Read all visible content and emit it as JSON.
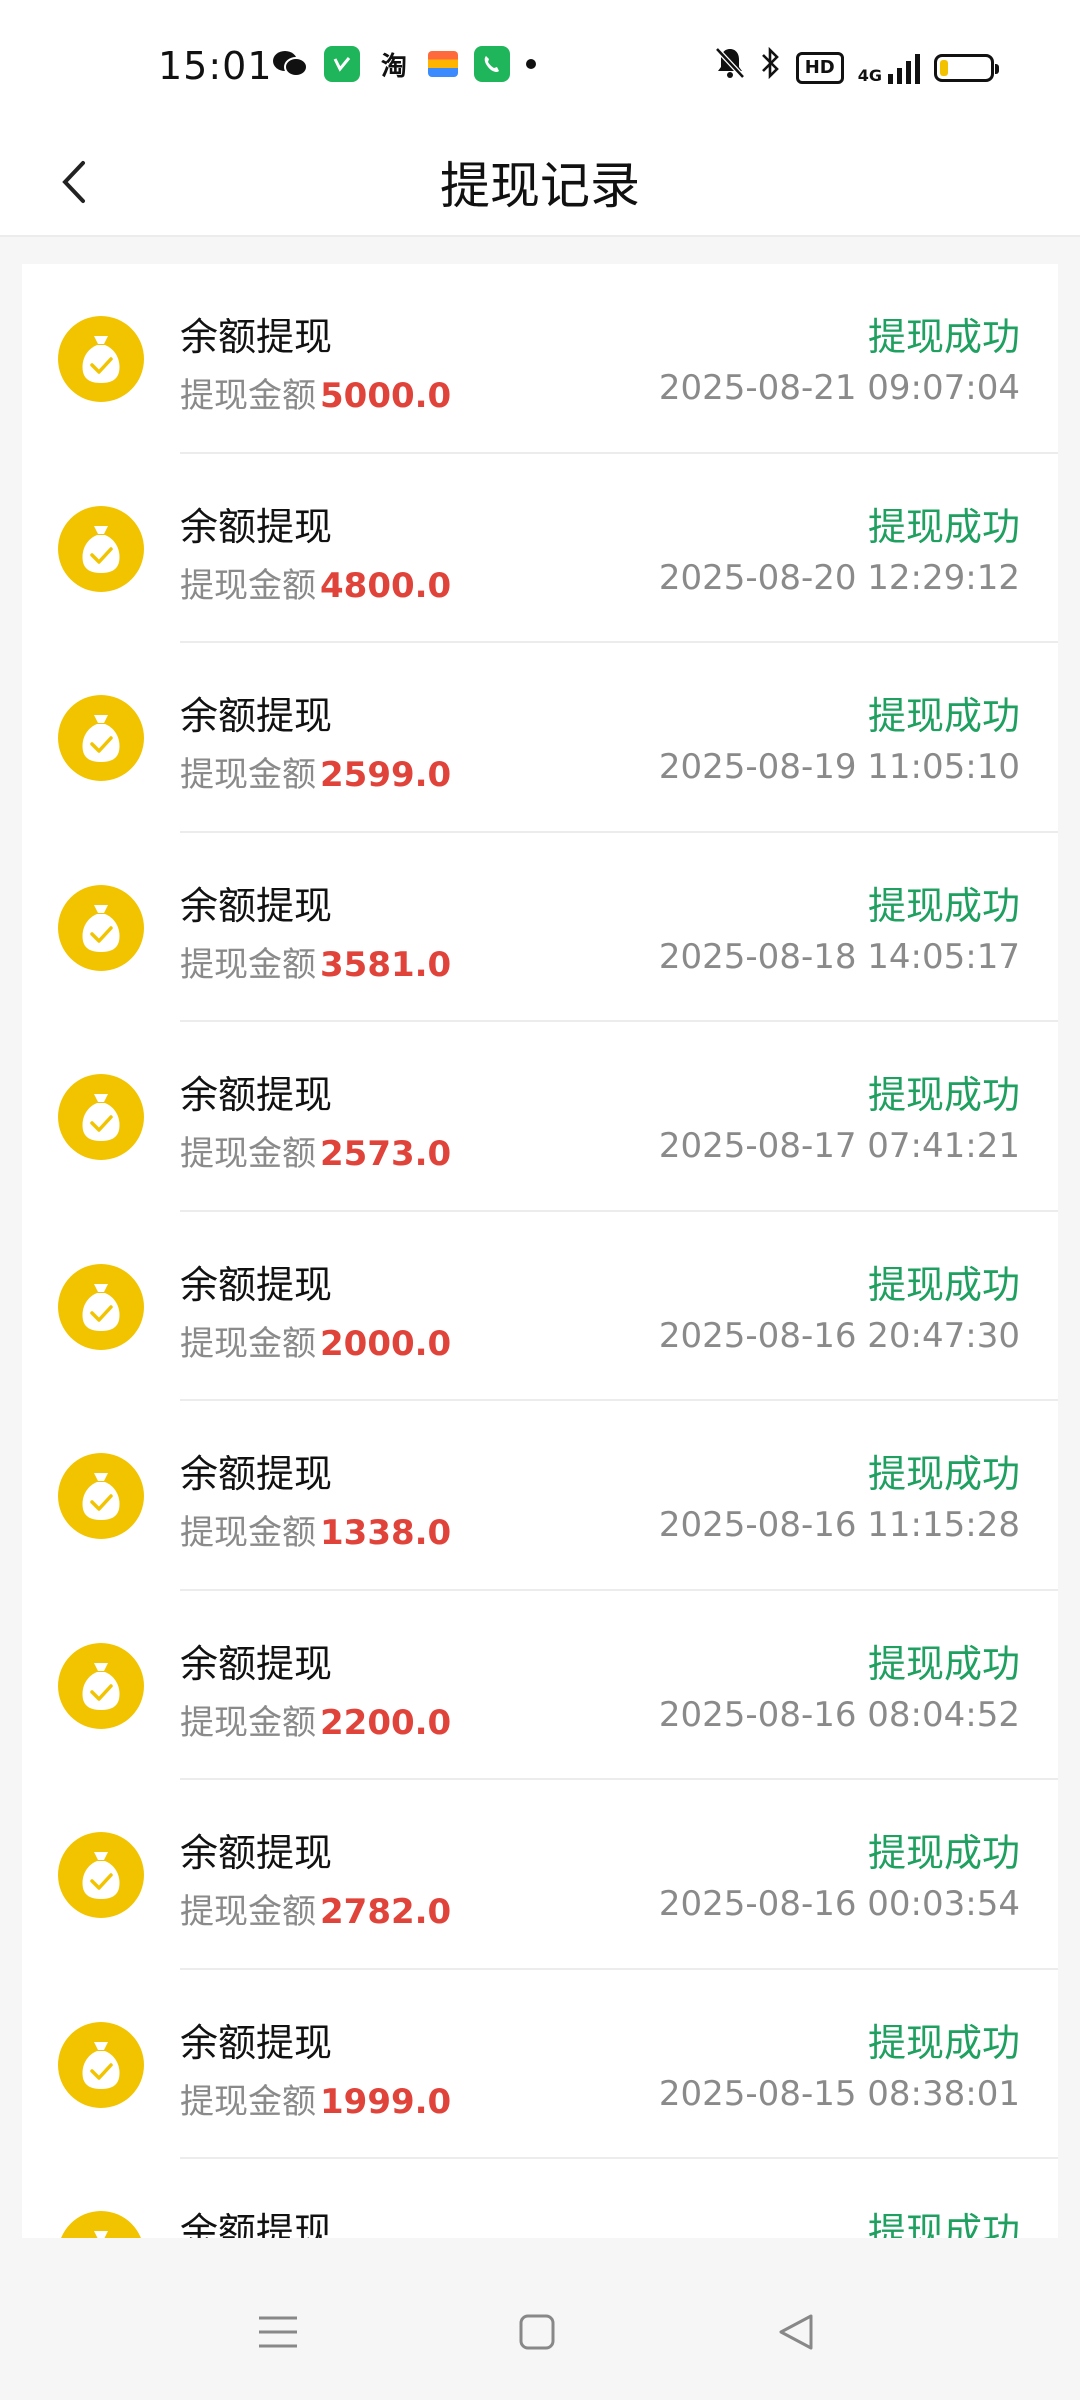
{
  "statusbar": {
    "time": "15:01",
    "apps": [
      "wechat-icon",
      "green-app-icon",
      "taobao-icon",
      "wallet-icon",
      "phone-icon"
    ],
    "taobao_glyph": "淘",
    "hd_label": "HD",
    "network": "4G",
    "battery_level": 0.15
  },
  "header": {
    "title": "提现记录"
  },
  "records": [
    {
      "title": "余额提现",
      "status": "提现成功",
      "amount_label": "提现金额",
      "amount": "5000.0",
      "time": "2025-08-21 09:07:04"
    },
    {
      "title": "余额提现",
      "status": "提现成功",
      "amount_label": "提现金额",
      "amount": "4800.0",
      "time": "2025-08-20 12:29:12"
    },
    {
      "title": "余额提现",
      "status": "提现成功",
      "amount_label": "提现金额",
      "amount": "2599.0",
      "time": "2025-08-19 11:05:10"
    },
    {
      "title": "余额提现",
      "status": "提现成功",
      "amount_label": "提现金额",
      "amount": "3581.0",
      "time": "2025-08-18 14:05:17"
    },
    {
      "title": "余额提现",
      "status": "提现成功",
      "amount_label": "提现金额",
      "amount": "2573.0",
      "time": "2025-08-17 07:41:21"
    },
    {
      "title": "余额提现",
      "status": "提现成功",
      "amount_label": "提现金额",
      "amount": "2000.0",
      "time": "2025-08-16 20:47:30"
    },
    {
      "title": "余额提现",
      "status": "提现成功",
      "amount_label": "提现金额",
      "amount": "1338.0",
      "time": "2025-08-16 11:15:28"
    },
    {
      "title": "余额提现",
      "status": "提现成功",
      "amount_label": "提现金额",
      "amount": "2200.0",
      "time": "2025-08-16 08:04:52"
    },
    {
      "title": "余额提现",
      "status": "提现成功",
      "amount_label": "提现金额",
      "amount": "2782.0",
      "time": "2025-08-16 00:03:54"
    },
    {
      "title": "余额提现",
      "status": "提现成功",
      "amount_label": "提现金额",
      "amount": "1999.0",
      "time": "2025-08-15 08:38:01"
    },
    {
      "title": "余额提现",
      "status": "提现成功",
      "amount_label": "",
      "amount": "",
      "time": ""
    }
  ],
  "colors": {
    "status_success": "#1fa060",
    "amount": "#e0433a",
    "coin": "#f2c400"
  },
  "navbar": {
    "buttons": [
      "menu-icon",
      "home-icon",
      "back-icon"
    ]
  }
}
